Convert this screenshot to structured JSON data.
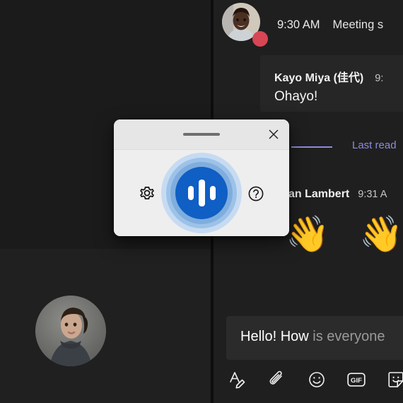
{
  "app": {
    "theme": "dark",
    "panel_bg": "#1f1f1f",
    "accent_blue": "#0f5fc4",
    "lastread_purple": "#8b8cdf",
    "busy_red": "#d74654"
  },
  "stage": {
    "self_view_name": "self-view-avatar"
  },
  "chat": {
    "system_message": {
      "time": "9:30 AM",
      "text": "Meeting s",
      "avatar": "participant-avatar",
      "presence": "busy"
    },
    "messages": [
      {
        "author": "Kayo Miya (佳代)",
        "time": "9:",
        "body": "Ohayo!"
      },
      {
        "author": "an Lambert",
        "time": "9:31 A",
        "body": "👋 👋 👋"
      }
    ],
    "last_read": {
      "label": "Last read"
    }
  },
  "compose": {
    "typed_text": "Hello! How",
    "dictating_text": "is everyone",
    "toolbar": [
      {
        "name": "format-icon",
        "label": "Format"
      },
      {
        "name": "attach-icon",
        "label": "Attach"
      },
      {
        "name": "emoji-icon",
        "label": "Emoji"
      },
      {
        "name": "gif-icon",
        "label": "GIF"
      },
      {
        "name": "sticker-icon",
        "label": "Sticker"
      }
    ]
  },
  "dictation_dialog": {
    "title_bar": {
      "drag_handle": "drag-handle",
      "close_label": "✕"
    },
    "settings_label": "Settings",
    "help_label": "Help",
    "mic_label": "Microphone",
    "mic_state": "listening",
    "mic_color": "#0f5fc4",
    "ring_colors": [
      "#7fadde",
      "#9dc2e8",
      "#c6dbf2"
    ]
  }
}
